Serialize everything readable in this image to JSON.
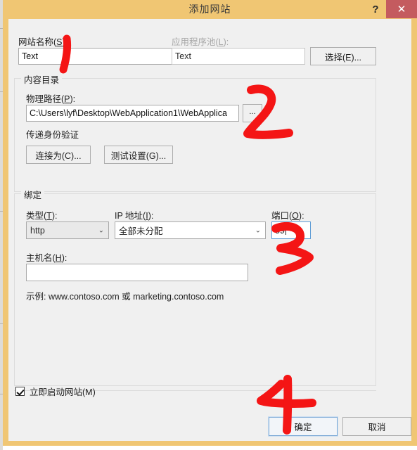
{
  "window": {
    "title": "添加网站",
    "help_label": "?",
    "close_label": "✕",
    "titlebar_color": "#f0c673",
    "close_color": "#c45b5f"
  },
  "site_name": {
    "label_text": "网站名称(",
    "label_accel": "S",
    "label_tail": "):",
    "value": "Text"
  },
  "app_pool": {
    "label_text": "应用程序池(",
    "label_accel": "L",
    "label_tail": "):",
    "value": "Text",
    "select_button": "选择(E)..."
  },
  "content_dir": {
    "group_title": "内容目录",
    "physical_path": {
      "label_text": "物理路径(",
      "label_accel": "P",
      "label_tail": "):",
      "value": "C:\\Users\\lyf\\Desktop\\WebApplication1\\WebApplica",
      "browse_button": "..."
    },
    "passthrough_label": "传递身份验证",
    "connect_as_button": "连接为(C)...",
    "test_settings_button": "测试设置(G)..."
  },
  "binding": {
    "group_title": "绑定",
    "type": {
      "label_text": "类型(",
      "label_accel": "T",
      "label_tail": "):",
      "value": "http",
      "arrow": "⌄"
    },
    "ip_address": {
      "label_text": "IP 地址(",
      "label_accel": "I",
      "label_tail": "):",
      "value": "全部未分配",
      "arrow": "⌄"
    },
    "port": {
      "label_text": "端口(",
      "label_accel": "O",
      "label_tail": "):",
      "value": "89"
    },
    "host_name": {
      "label_text": "主机名(",
      "label_accel": "H",
      "label_tail": "):",
      "value": ""
    },
    "example_text": "示例: www.contoso.com 或 marketing.contoso.com"
  },
  "footer": {
    "start_now_label": "立即启动网站(M)",
    "start_now_checked": true,
    "ok_button": "确定",
    "cancel_button": "取消"
  },
  "annotations": {
    "color": "#f41515",
    "items": [
      {
        "name": "annotation-1",
        "label": "1"
      },
      {
        "name": "annotation-2",
        "label": "2"
      },
      {
        "name": "annotation-3",
        "label": "3"
      },
      {
        "name": "annotation-4",
        "label": "4"
      }
    ]
  }
}
